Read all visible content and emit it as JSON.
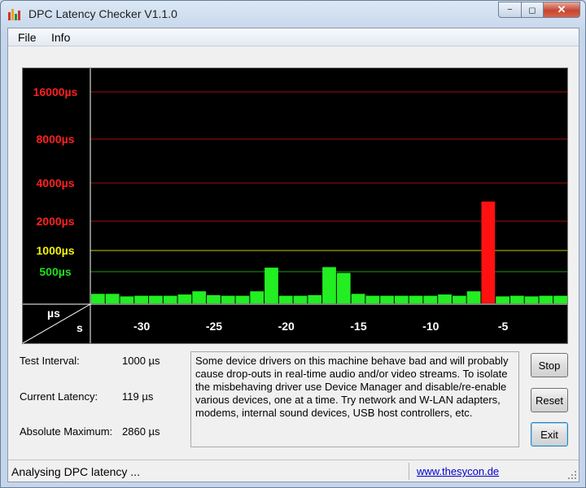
{
  "window": {
    "title": "DPC Latency Checker V1.1.0",
    "caption_min": "−",
    "caption_max": "◻",
    "caption_close": "✕"
  },
  "menu": [
    {
      "label": "File"
    },
    {
      "label": "Info"
    }
  ],
  "graph": {
    "y_labels": [
      {
        "text": "16000µs",
        "color": "#ff2020"
      },
      {
        "text": "8000µs",
        "color": "#ff2020"
      },
      {
        "text": "4000µs",
        "color": "#ff2020"
      },
      {
        "text": "2000µs",
        "color": "#ff2020"
      },
      {
        "text": "1000µs",
        "color": "#f2f20a"
      },
      {
        "text": "500µs",
        "color": "#1ee01e"
      }
    ],
    "corner_top": "µs",
    "corner_bottom": "s",
    "x_ticks": [
      "-30",
      "-25",
      "-20",
      "-15",
      "-10",
      "-5"
    ],
    "colors": {
      "green": "#22ee22",
      "red": "#ff1111",
      "grid_red": "#a01010",
      "grid_yellow": "#c8c800",
      "grid_green": "#10a010"
    }
  },
  "chart_data": {
    "type": "bar",
    "xlabel": "s",
    "ylabel": "µs",
    "x": [
      -33,
      -32,
      -31,
      -30,
      -29,
      -28,
      -27,
      -26,
      -25,
      -24,
      -23,
      -22,
      -21,
      -20,
      -19,
      -18,
      -17,
      -16,
      -15,
      -14,
      -13,
      -12,
      -11,
      -10,
      -9,
      -8,
      -7,
      -6,
      -5,
      -4,
      -3,
      -2,
      -1
    ],
    "values": [
      150,
      150,
      110,
      120,
      120,
      120,
      140,
      190,
      130,
      120,
      120,
      190,
      570,
      120,
      120,
      130,
      580,
      480,
      150,
      120,
      120,
      120,
      120,
      120,
      140,
      120,
      190,
      2860,
      110,
      120,
      110,
      120,
      120
    ],
    "colors": [
      "green",
      "green",
      "green",
      "green",
      "green",
      "green",
      "green",
      "green",
      "green",
      "green",
      "green",
      "green",
      "green",
      "green",
      "green",
      "green",
      "green",
      "green",
      "green",
      "green",
      "green",
      "green",
      "green",
      "green",
      "green",
      "green",
      "green",
      "red",
      "green",
      "green",
      "green",
      "green",
      "green"
    ],
    "y_ticks": [
      500,
      1000,
      2000,
      4000,
      8000,
      16000
    ],
    "y_scale": "log2",
    "grid": true
  },
  "info": {
    "test_interval_label": "Test Interval:",
    "test_interval_value": "1000 µs",
    "current_latency_label": "Current Latency:",
    "current_latency_value": "119 µs",
    "absolute_maximum_label": "Absolute Maximum:",
    "absolute_maximum_value": "2860 µs"
  },
  "message": "Some device drivers on this machine behave bad and will probably cause drop-outs in real-time audio and/or video streams. To isolate the misbehaving driver use Device Manager and disable/re-enable various devices, one at a time. Try network and W-LAN adapters, modems, internal sound devices, USB host controllers, etc.",
  "buttons": {
    "stop": "Stop",
    "reset": "Reset",
    "exit": "Exit"
  },
  "status": {
    "text": "Analysing DPC latency ...",
    "link": "www.thesycon.de"
  }
}
